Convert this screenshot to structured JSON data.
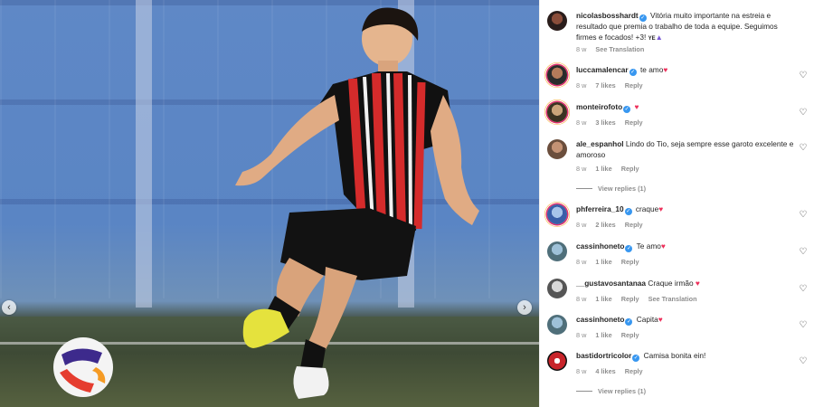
{
  "post": {
    "author": "nicolasbosshardt",
    "caption": "Vitória muito importante na estreia e resultado que premia o trabalho de toda a equipe. Seguimos firmes e focados! +3! ",
    "caption_suffix": "YE",
    "age": "8 w",
    "translation": "See Translation"
  },
  "comments": [
    {
      "user": "luccamalencar",
      "verified": true,
      "text": "te amo",
      "heart": true,
      "age": "8 w",
      "likes": "7 likes",
      "reply": "Reply"
    },
    {
      "user": "monteirofoto",
      "verified": true,
      "text": "",
      "heart": true,
      "age": "8 w",
      "likes": "3 likes",
      "reply": "Reply"
    },
    {
      "user": "ale_espanhol",
      "verified": false,
      "text": "Lindo do Tio, seja sempre esse garoto excelente e amoroso",
      "heart": false,
      "age": "8 w",
      "likes": "1 like",
      "reply": "Reply",
      "view_replies": "View replies (1)"
    },
    {
      "user": "phferreira_10",
      "verified": true,
      "text": "craque",
      "heart": true,
      "age": "8 w",
      "likes": "2 likes",
      "reply": "Reply"
    },
    {
      "user": "cassinhoneto",
      "verified": true,
      "text": "Te amo",
      "heart": true,
      "age": "8 w",
      "likes": "1 like",
      "reply": "Reply"
    },
    {
      "user": "__gustavosantanaa",
      "verified": false,
      "text": "Craque irmão",
      "heart": true,
      "age": "8 w",
      "likes": "1 like",
      "reply": "Reply",
      "translation": "See Translation"
    },
    {
      "user": "cassinhoneto",
      "verified": true,
      "text": "Capita",
      "heart": true,
      "age": "8 w",
      "likes": "1 like",
      "reply": "Reply"
    },
    {
      "user": "bastidortricolor",
      "verified": true,
      "text": "Camisa bonita ein!",
      "heart": false,
      "age": "8 w",
      "likes": "4 likes",
      "reply": "Reply",
      "view_replies": "View replies (1)"
    }
  ],
  "icons": {
    "like": "heart-outline-icon",
    "verified": "verified-badge-icon",
    "prev": "chevron-left-icon",
    "next": "chevron-right-icon"
  },
  "colors": {
    "accent": "#3897f0",
    "heart": "#ed2f5a",
    "muted": "#8e8e8e"
  }
}
